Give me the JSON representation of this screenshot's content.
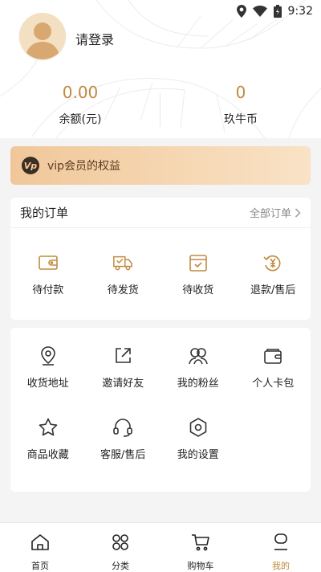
{
  "status_bar": {
    "time": "9:32"
  },
  "profile": {
    "login_text": "请登录"
  },
  "stats": {
    "balance_value": "0.00",
    "balance_label": "余额(元)",
    "coins_value": "0",
    "coins_label": "玖牛币"
  },
  "vip": {
    "badge": "Vp",
    "text": "vip会员的权益"
  },
  "orders": {
    "title": "我的订单",
    "all_label": "全部订单",
    "items": [
      {
        "label": "待付款",
        "icon": "wallet-icon"
      },
      {
        "label": "待发货",
        "icon": "truck-icon"
      },
      {
        "label": "待收货",
        "icon": "box-check-icon"
      },
      {
        "label": "退款/售后",
        "icon": "refund-icon"
      }
    ]
  },
  "tools": {
    "items": [
      {
        "label": "收货地址",
        "icon": "location-icon"
      },
      {
        "label": "邀请好友",
        "icon": "share-icon"
      },
      {
        "label": "我的粉丝",
        "icon": "fans-icon"
      },
      {
        "label": "个人卡包",
        "icon": "card-wallet-icon"
      },
      {
        "label": "商品收藏",
        "icon": "star-icon"
      },
      {
        "label": "客服/售后",
        "icon": "headset-icon"
      },
      {
        "label": "我的设置",
        "icon": "settings-icon"
      }
    ]
  },
  "nav": {
    "items": [
      {
        "label": "首页",
        "icon": "home-icon"
      },
      {
        "label": "分类",
        "icon": "category-icon"
      },
      {
        "label": "购物车",
        "icon": "cart-icon"
      },
      {
        "label": "我的",
        "icon": "profile-icon"
      }
    ],
    "active": "我的"
  },
  "colors": {
    "accent": "#c18a3f",
    "vip_gradient_start": "#f0c79a",
    "vip_gradient_end": "#f9e2c6"
  }
}
